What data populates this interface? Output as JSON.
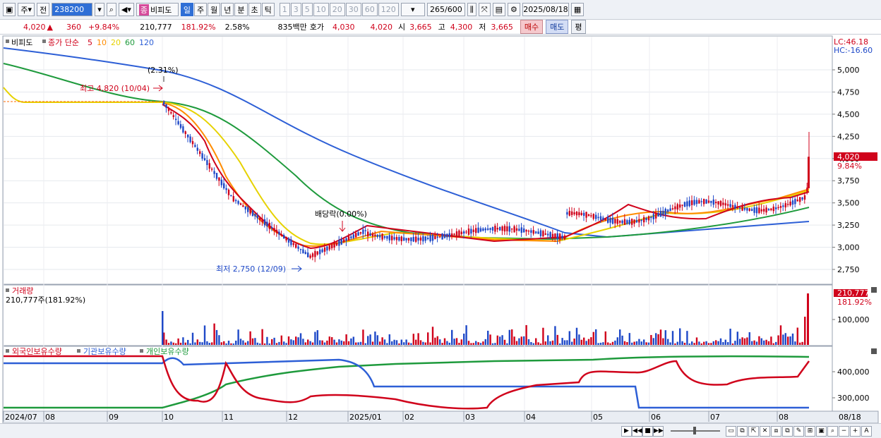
{
  "toolbar": {
    "period_a": "주",
    "period_b": "전",
    "code": "238200",
    "name_tag": "종",
    "name": "비피도",
    "intervals": [
      "일",
      "주",
      "월",
      "년",
      "분",
      "초",
      "틱"
    ],
    "active_interval": "일",
    "multiples": [
      "1",
      "3",
      "5",
      "10",
      "20",
      "30",
      "60",
      "120"
    ],
    "count": "265",
    "count_total": "/600",
    "date": "2025/08/18"
  },
  "info": {
    "price": "4,020",
    "arrow": "▲",
    "change": "360",
    "change_pct": "+9.84%",
    "volume": "210,777",
    "volume_ratio": "181.92%",
    "turnover": "2.58%",
    "amount": "835백만",
    "quote_label": "호가",
    "quote_value": "4,030",
    "quote_value2": "4,020",
    "open_label": "시",
    "open": "3,665",
    "high_label": "고",
    "high": "4,300",
    "low_label": "저",
    "low": "3,665",
    "buy": "매수",
    "sell": "매도",
    "eval": "평"
  },
  "price_panel": {
    "legend_name": "비피도",
    "legend_type": "종가 단순",
    "ma": [
      {
        "label": "5",
        "color": "#d0021b"
      },
      {
        "label": "10",
        "color": "#ff8c00"
      },
      {
        "label": "20",
        "color": "#e6d200"
      },
      {
        "label": "60",
        "color": "#1e9a3c"
      },
      {
        "label": "120",
        "color": "#2d5fd6"
      }
    ],
    "lc": "LC:46.18",
    "hc": "HC:-16.60",
    "y_ticks": [
      "5,000",
      "4,750",
      "4,500",
      "4,250",
      "4,000",
      "3,750",
      "3,500",
      "3,250",
      "3,000",
      "2,750"
    ],
    "y_values": [
      5000,
      4750,
      4500,
      4250,
      4000,
      3750,
      3500,
      3250,
      3000,
      2750
    ],
    "last_price": "4,020",
    "last_pct": "9.84%",
    "ann_high_pct": "(2.31%)",
    "ann_high": "최고 4,820 (10/04)",
    "ann_div": "배당락(0.00%)",
    "ann_low": "최저 2,750 (12/09)"
  },
  "volume_panel": {
    "title": "거래량",
    "value": "210,777주(181.92%)",
    "tick": "100,000",
    "tick_value": 100000,
    "last": "210,777",
    "last_pct": "181.92%"
  },
  "holdings_panel": {
    "legend": [
      {
        "label": "외국인보유수량",
        "color": "#d0021b"
      },
      {
        "label": "기관보유수량",
        "color": "#2d5fd6"
      },
      {
        "label": "개인보유수량",
        "color": "#1e9a3c"
      }
    ],
    "ticks": [
      "400,000",
      "300,000"
    ],
    "tick_values": [
      400000,
      300000
    ]
  },
  "x_axis": [
    "2024/07",
    "08",
    "09",
    "10",
    "11",
    "12",
    "2025/01",
    "02",
    "03",
    "04",
    "05",
    "06",
    "07",
    "08",
    "08/18"
  ],
  "colors": {
    "up": "#d0021b",
    "down": "#1f49c8",
    "accent": "#2f6fd6"
  }
}
